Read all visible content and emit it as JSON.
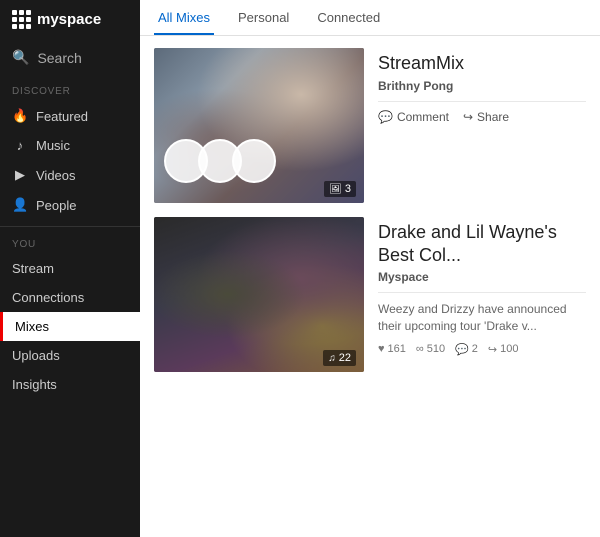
{
  "app": {
    "logo_text": "myspace",
    "logo_icon": "grid-icon"
  },
  "sidebar": {
    "search_label": "Search",
    "discover_label": "DISCOVER",
    "you_label": "YOU",
    "items_discover": [
      {
        "id": "featured",
        "label": "Featured",
        "icon": "🔥"
      },
      {
        "id": "music",
        "label": "Music",
        "icon": "🎵"
      },
      {
        "id": "videos",
        "label": "Videos",
        "icon": "▶"
      },
      {
        "id": "people",
        "label": "People",
        "icon": "👤"
      }
    ],
    "items_you": [
      {
        "id": "stream",
        "label": "Stream"
      },
      {
        "id": "connections",
        "label": "Connections"
      },
      {
        "id": "mixes",
        "label": "Mixes",
        "active": true
      },
      {
        "id": "uploads",
        "label": "Uploads"
      },
      {
        "id": "insights",
        "label": "Insights"
      }
    ]
  },
  "tabs": [
    {
      "id": "all-mixes",
      "label": "All Mixes",
      "active": true
    },
    {
      "id": "personal",
      "label": "Personal"
    },
    {
      "id": "connected",
      "label": "Connected"
    }
  ],
  "cards": [
    {
      "id": "card-1",
      "title": "StreamMix",
      "author": "Brithny Pong",
      "badge_type": "image",
      "badge_count": "3",
      "actions": [
        {
          "id": "comment",
          "label": "Comment",
          "icon": "💬"
        },
        {
          "id": "share",
          "label": "Share",
          "icon": "↪"
        }
      ],
      "description": "",
      "stats": []
    },
    {
      "id": "card-2",
      "title": "Drake and Lil Wayne's Best Col...",
      "author": "Myspace",
      "badge_type": "music",
      "badge_count": "22",
      "actions": [],
      "description": "Weezy and Drizzy have announced their upcoming tour 'Drake v...",
      "stats": [
        {
          "icon": "♥",
          "value": "161"
        },
        {
          "icon": "∞",
          "value": "510"
        },
        {
          "icon": "💬",
          "value": "2"
        },
        {
          "icon": "↪",
          "value": "100"
        }
      ]
    }
  ],
  "icons": {
    "search": "🔍",
    "image_badge": "🖼",
    "music_badge": "🎵",
    "heart": "♥",
    "loop": "∞",
    "comment": "💬",
    "share": "↪"
  }
}
